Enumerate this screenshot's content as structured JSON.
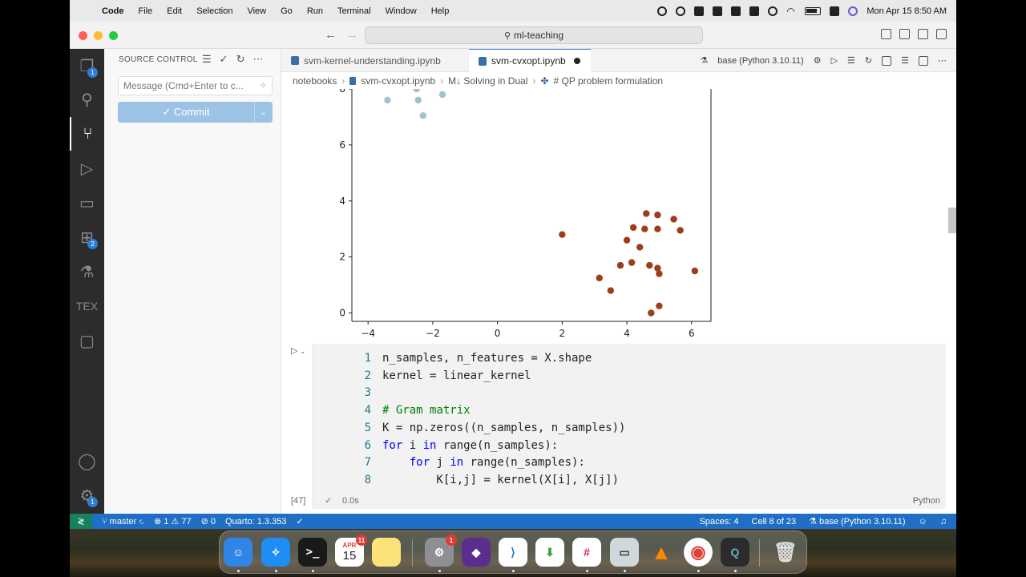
{
  "menubar": {
    "items": [
      "Code",
      "File",
      "Edit",
      "Selection",
      "View",
      "Go",
      "Run",
      "Terminal",
      "Window",
      "Help"
    ],
    "datetime": "Mon Apr 15  8:50 AM"
  },
  "titlebar": {
    "search": "ml-teaching"
  },
  "sidebar": {
    "header": "SOURCE CONTROL",
    "commit_placeholder": "Message (Cmd+Enter to c...",
    "commit_label": "✓ Commit",
    "badges": {
      "source_control": "1",
      "extensions": "2",
      "settings": "1"
    }
  },
  "tabs": [
    {
      "label": "svm-kernel-understanding.ipynb",
      "active": false
    },
    {
      "label": "svm-cvxopt.ipynb",
      "active": true,
      "modified": true
    }
  ],
  "kernel": "base (Python 3.10.11)",
  "breadcrumb": [
    "notebooks",
    "svm-cvxopt.ipynb",
    "M↓ Solving in Dual",
    "# QP problem formulation"
  ],
  "chart_data": {
    "type": "scatter",
    "xlim": [
      -4.5,
      6.6
    ],
    "ylim": [
      -0.3,
      8.0
    ],
    "xticks": [
      "−4",
      "−2",
      "0",
      "2",
      "4",
      "6"
    ],
    "xtick_values": [
      -4,
      -2,
      0,
      2,
      4,
      6
    ],
    "yticks": [
      "0",
      "2",
      "4",
      "6",
      "8"
    ],
    "ytick_values": [
      0,
      2,
      4,
      6,
      8
    ],
    "series": [
      {
        "color": "#9cc4cb",
        "points": [
          [
            -3.4,
            7.6
          ],
          [
            -2.5,
            8.0
          ],
          [
            -2.45,
            7.6
          ],
          [
            -2.3,
            7.05
          ],
          [
            -1.7,
            7.8
          ]
        ]
      },
      {
        "color": "#9a3e1c",
        "points": [
          [
            2.0,
            2.8
          ],
          [
            3.15,
            1.25
          ],
          [
            3.5,
            0.8
          ],
          [
            3.8,
            1.7
          ],
          [
            4.0,
            2.6
          ],
          [
            4.15,
            1.8
          ],
          [
            4.2,
            3.05
          ],
          [
            4.4,
            2.35
          ],
          [
            4.55,
            3.0
          ],
          [
            4.6,
            3.55
          ],
          [
            4.7,
            1.7
          ],
          [
            4.75,
            0.0
          ],
          [
            4.95,
            3.5
          ],
          [
            4.95,
            3.0
          ],
          [
            4.95,
            1.6
          ],
          [
            5.0,
            1.4
          ],
          [
            5.0,
            0.25
          ],
          [
            5.45,
            3.35
          ],
          [
            5.65,
            2.95
          ],
          [
            6.1,
            1.5
          ]
        ]
      }
    ]
  },
  "cell": {
    "lines": [
      "n_samples, n_features = X.shape",
      "kernel = linear_kernel",
      "",
      "# Gram matrix",
      "K = np.zeros((n_samples, n_samples))",
      "for i in range(n_samples):",
      "    for j in range(n_samples):",
      "        K[i,j] = kernel(X[i], X[j])"
    ],
    "exec_count": "[47]",
    "exec_time": "0.0s",
    "language": "Python"
  },
  "statusbar": {
    "branch": "master",
    "errors": "1",
    "warnings": "77",
    "ports": "0",
    "quarto": "Quarto: 1.3.353",
    "spaces": "Spaces: 4",
    "cell_pos": "Cell 8 of 23",
    "kernel": "base (Python 3.10.11)"
  },
  "dock": {
    "calendar_month": "APR",
    "calendar_day": "15",
    "calendar_badge": "11",
    "settings_badge": "1"
  }
}
